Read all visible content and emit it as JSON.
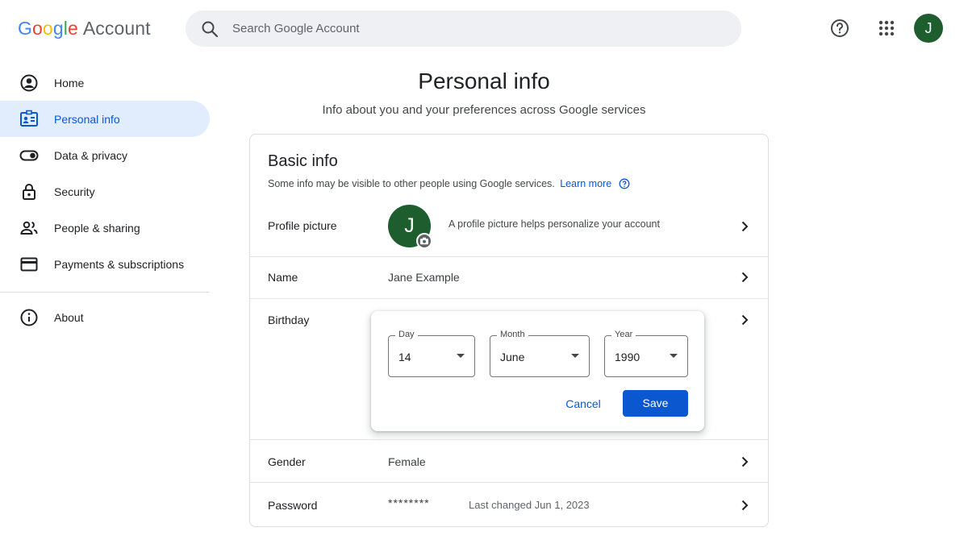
{
  "header": {
    "logo_brand": "Google",
    "logo_suffix": "Account",
    "search_placeholder": "Search Google Account",
    "help_icon": "help-circle-icon",
    "apps_icon": "apps-grid-icon",
    "avatar_initial": "J"
  },
  "sidebar": {
    "items": [
      {
        "label": "Home",
        "icon": "account-circle-icon"
      },
      {
        "label": "Personal info",
        "icon": "id-card-icon",
        "active": true
      },
      {
        "label": "Data & privacy",
        "icon": "toggle-icon"
      },
      {
        "label": "Security",
        "icon": "lock-icon"
      },
      {
        "label": "People & sharing",
        "icon": "people-icon"
      },
      {
        "label": "Payments & subscriptions",
        "icon": "credit-card-icon"
      }
    ],
    "about": {
      "label": "About",
      "icon": "info-icon"
    }
  },
  "page": {
    "title": "Personal info",
    "subtitle": "Info about you and your preferences across Google services"
  },
  "basic_info": {
    "title": "Basic info",
    "note": "Some info may be visible to other people using Google services.",
    "learn_more": "Learn more",
    "profile_picture": {
      "label": "Profile picture",
      "avatar_initial": "J",
      "hint": "A profile picture helps personalize your account"
    },
    "name": {
      "label": "Name",
      "value": "Jane Example"
    },
    "birthday": {
      "label": "Birthday",
      "day": {
        "legend": "Day",
        "value": "14"
      },
      "month": {
        "legend": "Month",
        "value": "June"
      },
      "year": {
        "legend": "Year",
        "value": "1990"
      },
      "cancel": "Cancel",
      "save": "Save"
    },
    "gender": {
      "label": "Gender",
      "value": "Female"
    },
    "password": {
      "label": "Password",
      "value": "********",
      "last_changed": "Last changed Jun 1, 2023"
    }
  },
  "colors": {
    "accent": "#0b57d0",
    "active_nav_bg": "#e1edfd",
    "avatar_bg": "#1e5e2e",
    "search_bg": "#eef0f3"
  }
}
